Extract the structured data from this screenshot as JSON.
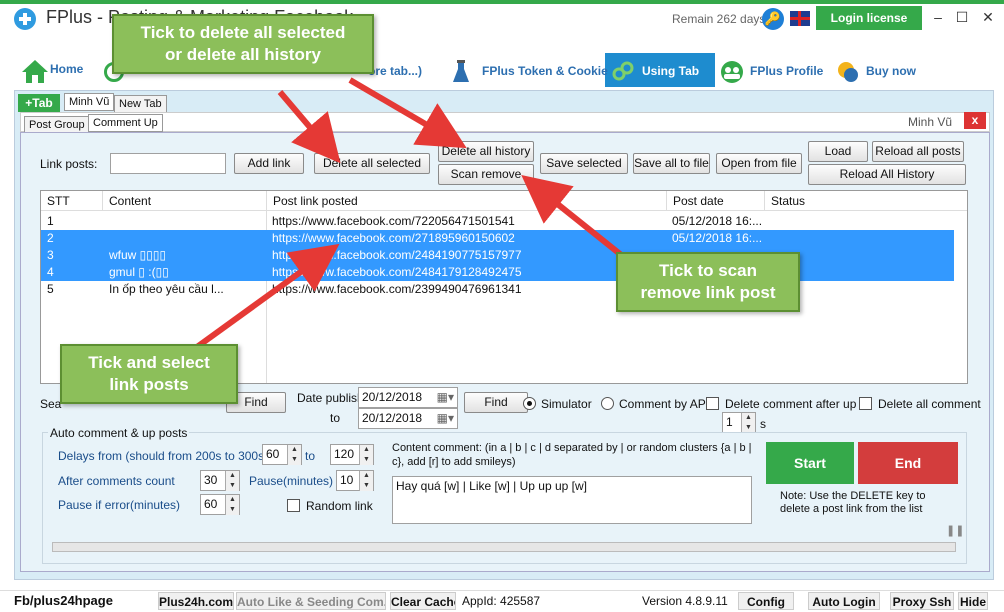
{
  "window": {
    "title": "FPlus - Posting & Marketing Facebook",
    "remain": "Remain 262 days",
    "login_label": "Login license",
    "minimize": "–",
    "maximize": "☐",
    "close": "✕"
  },
  "nav": {
    "home": "Home",
    "more_tab": "ore tab...)",
    "token": "FPlus Token & Cookie",
    "using_tab": "Using Tab",
    "profile": "FPlus Profile",
    "buy": "Buy now"
  },
  "tabs": {
    "add": "+Tab",
    "tab1": "Minh Vũ",
    "tab2": "New Tab"
  },
  "subtabs": {
    "post_group": "Post Group",
    "comment_up": "Comment Up",
    "account": "Minh Vũ",
    "close": "x"
  },
  "toolbar": {
    "link_posts_label": "Link posts:",
    "link_posts_value": "",
    "add_link": "Add link",
    "delete_selected": "Delete all selected",
    "delete_history": "Delete all history",
    "scan_remove": "Scan remove",
    "save_selected": "Save selected",
    "save_all": "Save all to file",
    "open_file": "Open from file",
    "load": "Load",
    "reload_posts": "Reload all posts",
    "reload_history": "Reload All History"
  },
  "table": {
    "headers": [
      "STT",
      "Content",
      "Post link posted",
      "Post date",
      "Status"
    ],
    "rows": [
      {
        "stt": "1",
        "content": "",
        "link": "https://www.facebook.com/722056471501541",
        "date": "05/12/2018 16:...",
        "status": "",
        "selected": false
      },
      {
        "stt": "2",
        "content": "",
        "link": "https://www.facebook.com/271895960150602",
        "date": "05/12/2018 16:...",
        "status": "",
        "selected": true
      },
      {
        "stt": "3",
        "content": "wfuw ▯▯▯▯",
        "link": "https://www.facebook.com/2484190775157977",
        "date": "",
        "status": "",
        "selected": true
      },
      {
        "stt": "4",
        "content": "gmul ▯ :(▯▯",
        "link": "https://www.facebook.com/2484179128492475",
        "date": "",
        "status": "",
        "selected": true
      },
      {
        "stt": "5",
        "content": "In ốp theo yêu cầu l...",
        "link": "https://www.facebook.com/2399490476961341",
        "date": "",
        "status": "",
        "selected": false
      }
    ]
  },
  "filter": {
    "search_label": "Sea",
    "find1": "Find",
    "date_publish": "Date publish:",
    "to": "to",
    "date_from": "20/12/2018",
    "date_to": "20/12/2018",
    "find2": "Find",
    "simulator": "Simulator",
    "comment_api": "Comment by API",
    "delete_after": "Delete comment after up",
    "delete_after_value": "1",
    "seconds": "s",
    "delete_all_comment": "Delete all comment"
  },
  "auto": {
    "title": "Auto comment & up posts",
    "delays_label": "Delays from (should from 200s to 300s)",
    "delay_from": "60",
    "delay_to_label": "to",
    "delay_to": "120",
    "after_label": "After comments count",
    "after_value": "30",
    "pause_label": "Pause(minutes)",
    "pause_value": "10",
    "pause_error_label": "Pause if error(minutes)",
    "pause_error_value": "60",
    "random_link": "Random link",
    "content_label": "Content comment: (in a | b | c | d separated by | or random clusters {a | b | c}, add [r] to add smileys)",
    "content_value": "Hay quá [w] | Like [w] | Up up up [w]",
    "start": "Start",
    "end": "End",
    "note": "Note: Use the DELETE key to delete a post link from the list"
  },
  "status": {
    "fb_page": "Fb/plus24hpage",
    "site": "Plus24h.com",
    "auto_like": "Auto Like & Seeding Com...",
    "clear_cache": "Clear Cache",
    "appid": "AppId: 425587",
    "version": "Version 4.8.9.11",
    "config": "Config",
    "auto_login": "Auto Login",
    "proxy": "Proxy Ssh",
    "hide": "Hide"
  },
  "callouts": {
    "tick_delete_1": "Tick to delete all selected",
    "tick_delete_2": "or delete all history",
    "tick_scan_1": "Tick to scan",
    "tick_scan_2": "remove link post",
    "tick_select_1": "Tick and select",
    "tick_select_2": "link posts"
  },
  "colors": {
    "brand_green": "#35a94a",
    "accent_blue": "#1e8ccf",
    "end_red": "#d33d3d",
    "callout_green": "#8cbf5a",
    "arrow_red": "#e53935",
    "selection_blue": "#3399ff"
  }
}
